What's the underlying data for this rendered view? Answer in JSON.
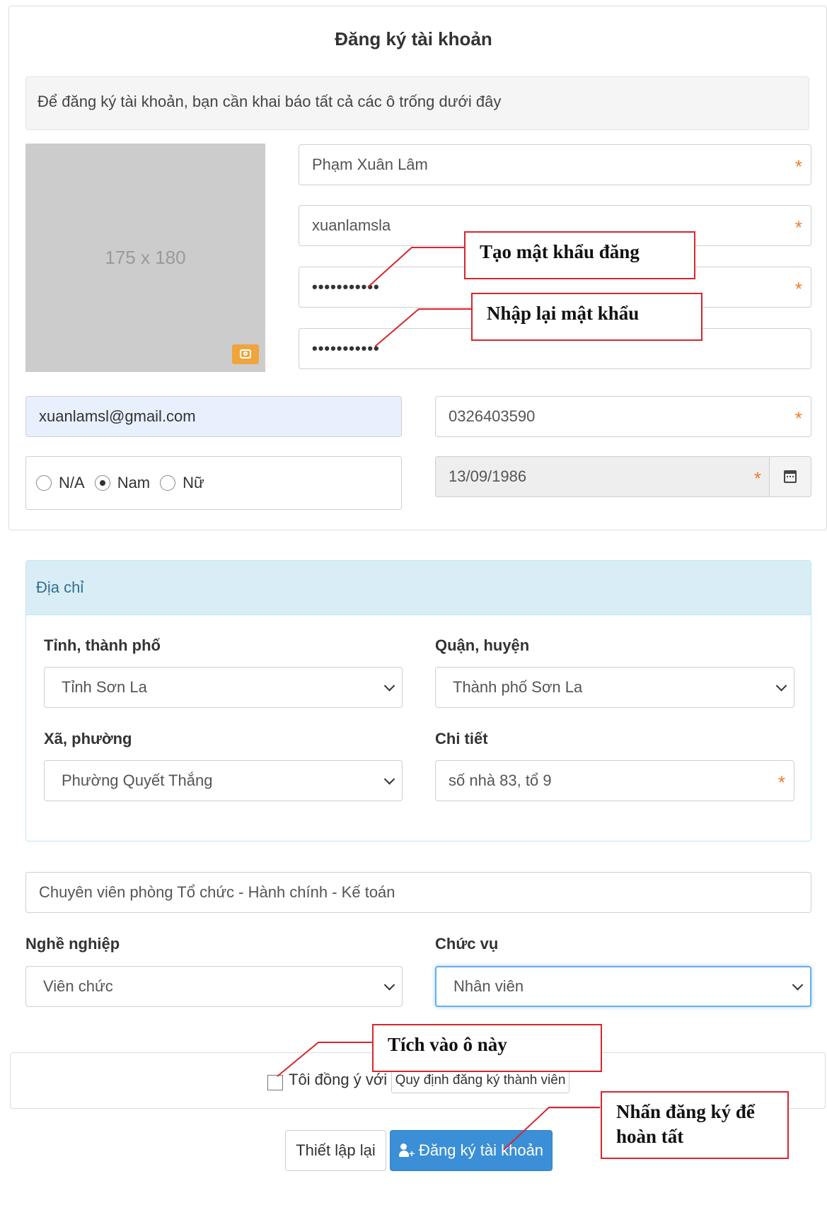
{
  "form": {
    "title": "Đăng ký tài khoản",
    "notice": "Để đăng ký tài khoản, bạn cần khai báo tất cả các ô trống dưới đây",
    "photo_placeholder": "175 x 180",
    "full_name": "Phạm Xuân Lâm",
    "username": "xuanlamsla",
    "password_mask": "•••••••••••",
    "confirm_password_mask": "•••••••••••",
    "email": "xuanlamsl@gmail.com",
    "phone": "0326403590",
    "birth_date": "13/09/1986",
    "required_mark": "*",
    "gender": {
      "options": [
        "N/A",
        "Nam",
        "Nữ"
      ],
      "selected": "Nam"
    }
  },
  "address": {
    "header": "Địa chỉ",
    "province_label": "Tỉnh, thành phố",
    "province_value": "Tỉnh Sơn La",
    "district_label": "Quận, huyện",
    "district_value": "Thành phố Sơn La",
    "ward_label": "Xã, phường",
    "ward_value": "Phường Quyết Thắng",
    "detail_label": "Chi tiết",
    "detail_value": "số nhà 83, tổ 9"
  },
  "job": {
    "position_text": "Chuyên viên phòng Tổ chức - Hành chính - Kế toán",
    "occupation_label": "Nghề nghiệp",
    "occupation_value": "Viên chức",
    "role_label": "Chức vụ",
    "role_value": "Nhân viên"
  },
  "terms": {
    "agree_text": "Tôi đồng ý với",
    "rules_button": "Quy định đăng ký thành viên"
  },
  "actions": {
    "reset_label": "Thiết lập lại",
    "submit_label": "Đăng ký tài khoản"
  },
  "annotations": {
    "create_password": "Tạo mật khẩu đăng",
    "retype_password": "Nhập lại mật khẩu",
    "tick_here": "Tích vào ô này",
    "click_register": "Nhấn đăng ký để hoàn tất"
  },
  "colors": {
    "accent": "#3b8fd6",
    "required": "#f07c2a",
    "callout_border": "#d6262c",
    "address_header_bg": "#d9edf7"
  }
}
